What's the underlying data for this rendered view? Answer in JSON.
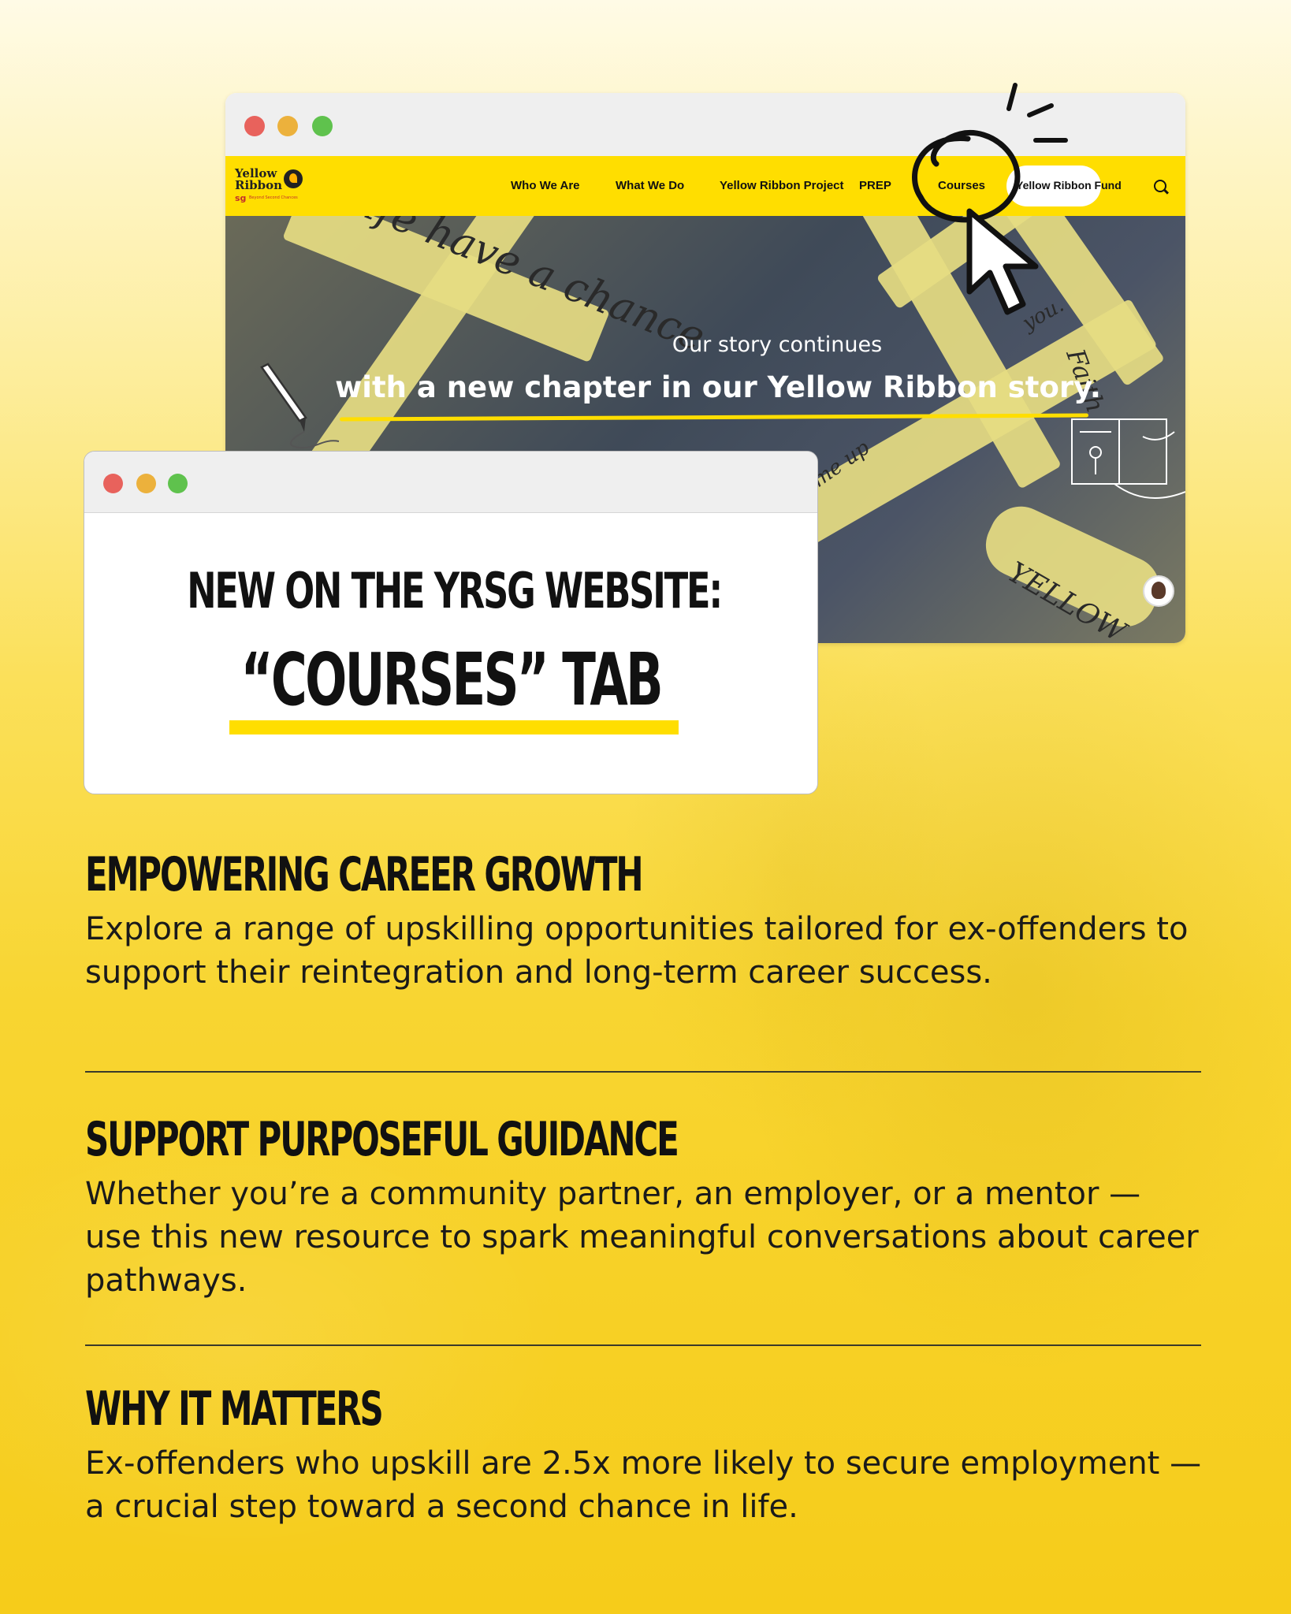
{
  "back_window": {
    "nav": {
      "logo_line1": "Yellow",
      "logo_line2": "Ribbon",
      "logo_sg": "sg",
      "logo_tagline": "Beyond Second Chances",
      "items": [
        "Who We Are",
        "What We Do",
        "Yellow Ribbon Project",
        "PREP",
        "Courses"
      ],
      "fund_button": "Yellow Ribbon Fund",
      "search_icon": "search-icon"
    },
    "hero": {
      "subtitle": "Our story continues",
      "headline": "with a new chapter in our Yellow Ribbon story.",
      "ribbon_notes": [
        "Life have a chance",
        "Faith",
        "YELLOW",
        "you.",
        "me up"
      ]
    },
    "chat_icon": "chat-avatar-icon"
  },
  "front_window": {
    "line1": "NEW ON THE YRSG WEBSITE:",
    "line2": "“COURSES” TAB"
  },
  "sections": [
    {
      "title": "EMPOWERING CAREER GROWTH",
      "body": "Explore a range of upskilling opportunities tailored for ex-offenders to support their reintegration and long-term career success."
    },
    {
      "title": "SUPPORT PURPOSEFUL GUIDANCE",
      "body": "Whether you’re a community partner, an employer, or a mentor — use this new resource to spark meaningful conversations about career pathways."
    },
    {
      "title": "WHY IT MATTERS",
      "body": "Ex-offenders who upskill are 2.5x more likely to secure employment — a crucial step toward a second chance in life."
    }
  ],
  "colors": {
    "brand_yellow": "#ffde00",
    "traffic_red": "#e8625c",
    "traffic_yellow": "#ecb13c",
    "traffic_green": "#5fc24d"
  }
}
